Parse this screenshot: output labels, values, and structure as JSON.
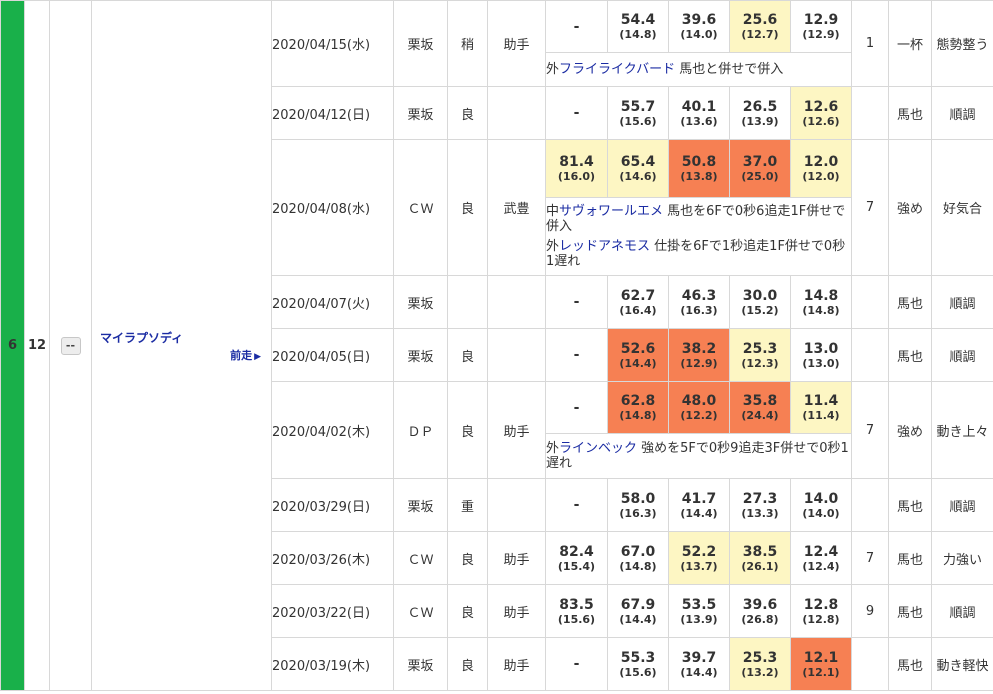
{
  "entry": {
    "waku": "6",
    "umaban": "12",
    "mark": "--",
    "horse_name": "マイラプソディ",
    "prev_label": "前走",
    "prev_icon": "triangle-right-icon"
  },
  "colors": {
    "waku": "#19b04a",
    "highlight_yellow": "#fdf6c3",
    "highlight_orange": "#f68053",
    "link": "#1b2ca3"
  },
  "rows": [
    {
      "date": "2020/04/15(水)",
      "course": "栗坂",
      "condition": "稍",
      "rider": "助手",
      "times": [
        {
          "v": "-"
        },
        {
          "v": "54.4",
          "s": "(14.8)"
        },
        {
          "v": "39.6",
          "s": "(14.0)"
        },
        {
          "v": "25.6",
          "s": "(12.7)"
        },
        {
          "v": "12.9",
          "s": "(12.9)"
        }
      ],
      "notes": [
        {
          "prefix": "外",
          "partner": "フライライクバード",
          "text": " 馬也と併せで併入"
        }
      ],
      "position": "1",
      "strength": "一杯",
      "comment": "態勢整う"
    },
    {
      "date": "2020/04/12(日)",
      "course": "栗坂",
      "condition": "良",
      "rider": "",
      "times": [
        {
          "v": "-"
        },
        {
          "v": "55.7",
          "s": "(15.6)"
        },
        {
          "v": "40.1",
          "s": "(13.6)"
        },
        {
          "v": "26.5",
          "s": "(13.9)"
        },
        {
          "v": "12.6",
          "s": "(12.6)"
        }
      ],
      "notes": [],
      "position": "",
      "strength": "馬也",
      "comment": "順調"
    },
    {
      "date": "2020/04/08(水)",
      "course": "ＣＷ",
      "condition": "良",
      "rider": "武豊",
      "times": [
        {
          "v": "81.4",
          "s": "(16.0)"
        },
        {
          "v": "65.4",
          "s": "(14.6)"
        },
        {
          "v": "50.8",
          "s": "(13.8)"
        },
        {
          "v": "37.0",
          "s": "(25.0)"
        },
        {
          "v": "12.0",
          "s": "(12.0)"
        }
      ],
      "notes": [
        {
          "prefix": "中",
          "partner": "サヴォワールエメ",
          "text": " 馬也を6Fで0秒6追走1F併せで併入"
        },
        {
          "prefix": "外",
          "partner": "レッドアネモス",
          "text": " 仕掛を6Fで1秒追走1F併せで0秒1遅れ"
        }
      ],
      "position": "7",
      "strength": "強め",
      "comment": "好気合"
    },
    {
      "date": "2020/04/07(火)",
      "course": "栗坂",
      "condition": "",
      "rider": "",
      "times": [
        {
          "v": "-"
        },
        {
          "v": "62.7",
          "s": "(16.4)"
        },
        {
          "v": "46.3",
          "s": "(16.3)"
        },
        {
          "v": "30.0",
          "s": "(15.2)"
        },
        {
          "v": "14.8",
          "s": "(14.8)"
        }
      ],
      "notes": [],
      "position": "",
      "strength": "馬也",
      "comment": "順調"
    },
    {
      "date": "2020/04/05(日)",
      "course": "栗坂",
      "condition": "良",
      "rider": "",
      "times": [
        {
          "v": "-"
        },
        {
          "v": "52.6",
          "s": "(14.4)"
        },
        {
          "v": "38.2",
          "s": "(12.9)"
        },
        {
          "v": "25.3",
          "s": "(12.3)"
        },
        {
          "v": "13.0",
          "s": "(13.0)"
        }
      ],
      "notes": [],
      "position": "",
      "strength": "馬也",
      "comment": "順調"
    },
    {
      "date": "2020/04/02(木)",
      "course": "ＤＰ",
      "condition": "良",
      "rider": "助手",
      "times": [
        {
          "v": "-"
        },
        {
          "v": "62.8",
          "s": "(14.8)"
        },
        {
          "v": "48.0",
          "s": "(12.2)"
        },
        {
          "v": "35.8",
          "s": "(24.4)"
        },
        {
          "v": "11.4",
          "s": "(11.4)"
        }
      ],
      "notes": [
        {
          "prefix": "外",
          "partner": "ラインベック",
          "text": " 強めを5Fで0秒9追走3F併せで0秒1遅れ"
        }
      ],
      "position": "7",
      "strength": "強め",
      "comment": "動き上々"
    },
    {
      "date": "2020/03/29(日)",
      "course": "栗坂",
      "condition": "重",
      "rider": "",
      "times": [
        {
          "v": "-"
        },
        {
          "v": "58.0",
          "s": "(16.3)"
        },
        {
          "v": "41.7",
          "s": "(14.4)"
        },
        {
          "v": "27.3",
          "s": "(13.3)"
        },
        {
          "v": "14.0",
          "s": "(14.0)"
        }
      ],
      "notes": [],
      "position": "",
      "strength": "馬也",
      "comment": "順調"
    },
    {
      "date": "2020/03/26(木)",
      "course": "ＣＷ",
      "condition": "良",
      "rider": "助手",
      "times": [
        {
          "v": "82.4",
          "s": "(15.4)"
        },
        {
          "v": "67.0",
          "s": "(14.8)"
        },
        {
          "v": "52.2",
          "s": "(13.7)"
        },
        {
          "v": "38.5",
          "s": "(26.1)"
        },
        {
          "v": "12.4",
          "s": "(12.4)"
        }
      ],
      "notes": [],
      "position": "7",
      "strength": "馬也",
      "comment": "力強い"
    },
    {
      "date": "2020/03/22(日)",
      "course": "ＣＷ",
      "condition": "良",
      "rider": "助手",
      "times": [
        {
          "v": "83.5",
          "s": "(15.6)"
        },
        {
          "v": "67.9",
          "s": "(14.4)"
        },
        {
          "v": "53.5",
          "s": "(13.9)"
        },
        {
          "v": "39.6",
          "s": "(26.8)"
        },
        {
          "v": "12.8",
          "s": "(12.8)"
        }
      ],
      "notes": [],
      "position": "9",
      "strength": "馬也",
      "comment": "順調"
    },
    {
      "date": "2020/03/19(木)",
      "course": "栗坂",
      "condition": "良",
      "rider": "助手",
      "times": [
        {
          "v": "-"
        },
        {
          "v": "55.3",
          "s": "(15.6)"
        },
        {
          "v": "39.7",
          "s": "(14.4)"
        },
        {
          "v": "25.3",
          "s": "(13.2)"
        },
        {
          "v": "12.1",
          "s": "(12.1)"
        }
      ],
      "notes": [],
      "position": "",
      "strength": "馬也",
      "comment": "動き軽快"
    }
  ]
}
